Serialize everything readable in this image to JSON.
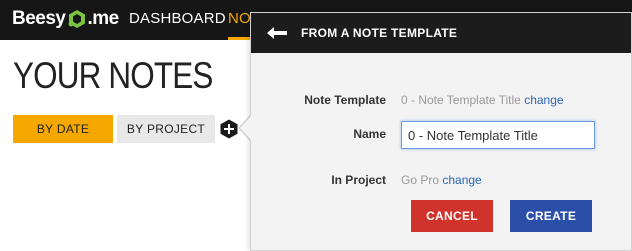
{
  "app": {
    "logo_left": "Beesy",
    "logo_right": "me"
  },
  "nav": {
    "dashboard": "DASHBOARD",
    "notes": "NOTES"
  },
  "page": {
    "title": "YOUR NOTES"
  },
  "filters": {
    "by_date": "BY DATE",
    "by_project": "BY PROJECT",
    "active": "BY DATE"
  },
  "popover": {
    "title": "FROM A NOTE TEMPLATE",
    "template_label": "Note Template",
    "template_value": "0 - Note Template Title",
    "template_change": "change",
    "name_label": "Name",
    "name_value": "0 - Note Template Title",
    "project_label": "In Project",
    "project_value": "Go Pro",
    "project_change": "change",
    "cancel_label": "CANCEL",
    "create_label": "CREATE"
  },
  "colors": {
    "accent": "#f6a800",
    "topbar": "#161616",
    "cancel": "#d0332b",
    "create": "#2b4fa8",
    "link": "#2a67b8"
  }
}
